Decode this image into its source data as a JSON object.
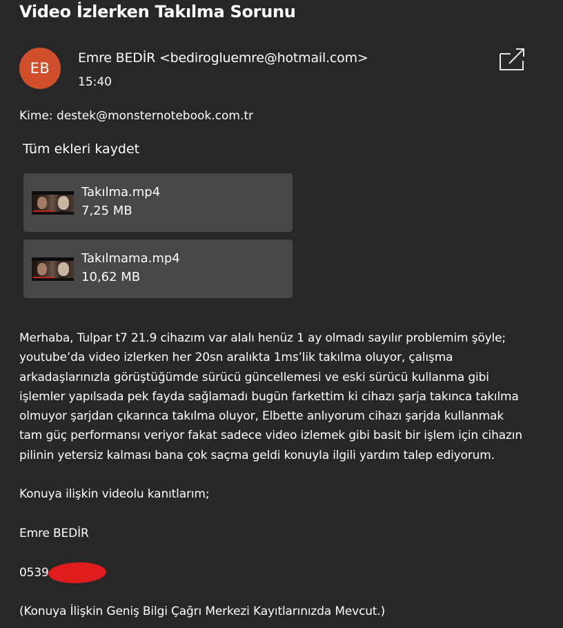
{
  "message": {
    "subject": "Video İzlerken Takılma Sorunu",
    "avatar_initials": "EB",
    "avatar_color": "#d04e2a",
    "sender": "Emre BEDİR <bedirogluemre@hotmail.com>",
    "time": "15:40",
    "to_line": "Kime: destek@monsternotebook.com.tr",
    "popout_icon": "open-in-new-window-icon"
  },
  "attachments": {
    "save_all_label": "Tüm ekleri kaydet",
    "items": [
      {
        "name": "Takılma.mp4",
        "size": "7,25 MB"
      },
      {
        "name": "Takılmama.mp4",
        "size": "10,62 MB"
      }
    ]
  },
  "body": {
    "paragraph_1_lines": [
      "Merhaba, Tulpar t7 21.9 cihazım var alalı henüz 1 ay olmadı sayılır problemim şöyle;",
      "youtube’da video izlerken her 20sn aralıkta 1ms’lik takılma oluyor, çalışma",
      "arkadaşlarınızla görüştüğümde sürücü güncellemesi ve eski sürücü kullanma gibi",
      "işlemler yapılsada pek fayda sağlamadı bugün farkettim ki cihazı şarja takınca takılma",
      "olmuyor şarjdan çıkarınca takılma oluyor, Elbette anlıyorum cihazı şarjda kullanmak",
      "tam güç performansı veriyor fakat sadece video izlemek gibi basit bir işlem için cihazın",
      "pilinin yetersiz kalması bana çok saçma geldi konuyla ilgili yardım talep ediyorum."
    ],
    "paragraph_2": "Konuya ilişkin videolu kanıtlarım;",
    "signature_name": "Emre BEDİR",
    "phone_visible": "0539",
    "redaction_color": "#e01b1b",
    "footer_note": "(Konuya İlişkin Geniş Bilgi Çağrı Merkezi Kayıtlarınızda Mevcut.)"
  }
}
